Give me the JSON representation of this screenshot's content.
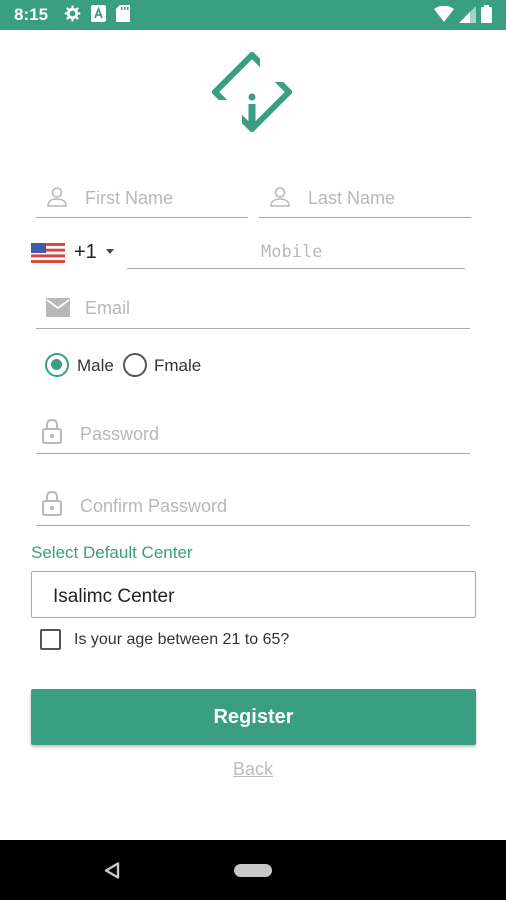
{
  "status_bar": {
    "time": "8:15",
    "icons_left": [
      "gear-icon",
      "a-icon",
      "sd-card-icon"
    ],
    "icons_right": [
      "wifi-icon",
      "signal-icon",
      "battery-icon"
    ]
  },
  "logo": {
    "name": "diamond-i-logo"
  },
  "form": {
    "first_name": {
      "placeholder": "First Name"
    },
    "last_name": {
      "placeholder": "Last Name"
    },
    "phone": {
      "country_code": "+1",
      "placeholder": "Mobile"
    },
    "email": {
      "placeholder": "Email"
    },
    "gender": {
      "options": [
        {
          "label": "Male",
          "checked": true
        },
        {
          "label": "Fmale",
          "checked": false
        }
      ]
    },
    "password": {
      "placeholder": "Password"
    },
    "confirm_password": {
      "placeholder": "Confirm Password"
    },
    "center": {
      "label": "Select Default Center",
      "value": "Isalimc Center"
    },
    "age_check": {
      "label": "Is your age between 21 to 65?",
      "checked": false
    }
  },
  "actions": {
    "register_label": "Register",
    "back_label": "Back"
  },
  "colors": {
    "accent": "#3a9e82",
    "placeholder": "#b8b8b8",
    "underline": "#a9a9a9"
  }
}
